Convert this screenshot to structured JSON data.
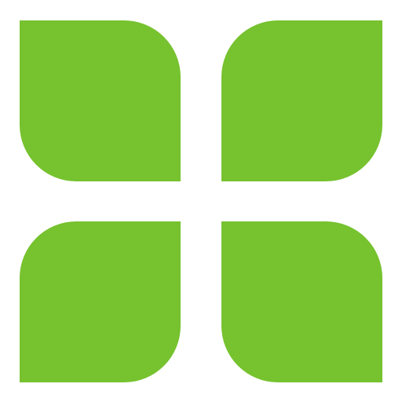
{
  "logo": {
    "icon": "four-leaf-grid-logo",
    "colors": {
      "background": "#ffffff",
      "leaf": "#76c22f"
    },
    "leaves": [
      {
        "name": "top-left"
      },
      {
        "name": "top-right"
      },
      {
        "name": "bottom-left"
      },
      {
        "name": "bottom-right"
      }
    ]
  }
}
